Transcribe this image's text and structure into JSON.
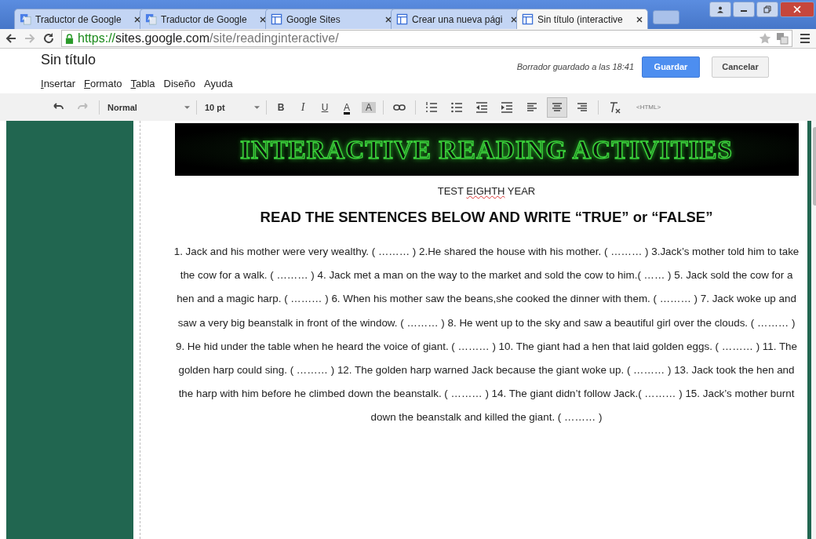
{
  "tabs": [
    {
      "label": "Traductor de Google",
      "selected": false
    },
    {
      "label": "Traductor de Google",
      "selected": false
    },
    {
      "label": "Google Sites",
      "selected": false
    },
    {
      "label": "Crear una nueva pági",
      "selected": false
    },
    {
      "label": "Sin título (interactive",
      "selected": true
    }
  ],
  "address": {
    "scheme": "https://",
    "host": "sites.google.com",
    "path": "/site/readinginteractive/"
  },
  "editor": {
    "title": "Sin título",
    "status": "Borrador guardado a las 18:41",
    "save": "Guardar",
    "cancel": "Cancelar",
    "menu": [
      {
        "label": "Insertar",
        "underlined_key": true
      },
      {
        "label": "Formato",
        "underlined_key": true
      },
      {
        "label": "Tabla",
        "underlined_key": true
      },
      {
        "label": "Diseño",
        "underlined_key": false
      },
      {
        "label": "Ayuda",
        "underlined_key": false
      }
    ],
    "toolbar": {
      "style": "Normal",
      "size": "10 pt",
      "bold": "B",
      "italic": "I",
      "underline": "U",
      "font_color": "A",
      "highlight": "A",
      "html": "<HTML>",
      "buttons": [
        {
          "kind": "undo",
          "disabled": false
        },
        {
          "kind": "redo",
          "disabled": true
        }
      ],
      "aligns": [
        {
          "kind": "left",
          "selected": false
        },
        {
          "kind": "center",
          "selected": true
        },
        {
          "kind": "right",
          "selected": false
        }
      ]
    }
  },
  "page": {
    "banner": "INTERACTIVE READING ACTIVITIES",
    "subtitle_prefix": "TEST ",
    "subtitle_flagged": "EIGHTH",
    "subtitle_suffix": " YEAR",
    "heading": "READ THE SENTENCES BELOW AND WRITE “TRUE” or “FALSE”",
    "body": "1. Jack and his mother were very wealthy. ( ……… ) 2.He shared the house with his mother. ( ……… ) 3.Jack’s mother told him to take the cow for a walk. ( ……… ) 4. Jack met a man on the way to the market and sold the cow to him.( …… ) 5. Jack sold the cow for a hen and a magic harp. ( ……… ) 6. When his mother saw the beans,she cooked the dinner with them. ( ……… ) 7. Jack woke up and saw a very big beanstalk in front of the window. ( ……… ) 8. He went up to the sky and saw a beautiful girl over the clouds. ( ……… ) 9. He hid under the table when he heard the voice of giant. ( ……… ) 10. The giant had a hen that laid golden eggs. ( ……… ) 11. The golden harp could sing. ( ……… ) 12. The golden harp warned Jack because the giant woke up. ( ……… ) 13. Jack took the hen and the harp with him before he climbed down the beanstalk. ( ……… ) 14. The giant didn’t follow Jack.( ……… ) 15. Jack’s mother burnt down the beanstalk and killed the giant. ( ……… )"
  }
}
